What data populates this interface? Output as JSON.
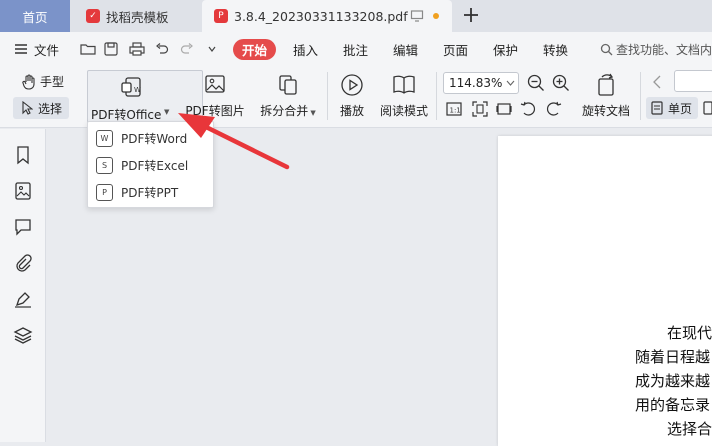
{
  "tabs": {
    "home": "首页",
    "template": "找稻壳模板",
    "document": "3.8.4_20230331133208.pdf"
  },
  "menubar": {
    "file": "文件",
    "items": [
      "开始",
      "插入",
      "批注",
      "编辑",
      "页面",
      "保护",
      "转换"
    ],
    "search_placeholder": "查找功能、文档内"
  },
  "ribbon": {
    "hand": "手型",
    "select": "选择",
    "pdf_to_office": "PDF转Office",
    "pdf_to_image": "PDF转图片",
    "split_merge": "拆分合并",
    "play": "播放",
    "read_mode": "阅读模式",
    "zoom": "114.83%",
    "rotate": "旋转文档",
    "single_page": "单页"
  },
  "dropdown": {
    "items": [
      "PDF转Word",
      "PDF转Excel",
      "PDF转PPT"
    ]
  },
  "document": {
    "lines": [
      "在现代",
      "随着日程越",
      "成为越来越",
      "用的备忘录",
      "选择合"
    ]
  },
  "colors": {
    "accent": "#e54b4b",
    "home_tab": "#7b93c9",
    "arrow": "#e8363a"
  }
}
